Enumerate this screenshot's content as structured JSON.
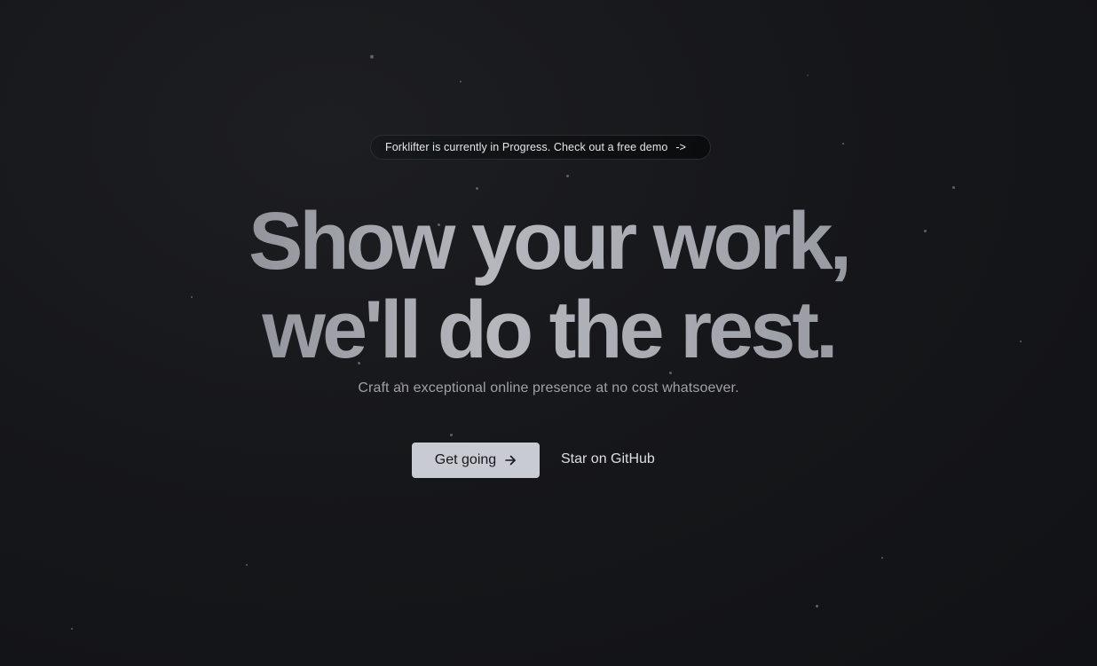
{
  "announcement": {
    "text": "Forklifter is currently in Progress. Check out a free demo",
    "arrow": "->"
  },
  "hero": {
    "headline_line1": "Show your work,",
    "headline_line2": "we'll do the rest.",
    "subtitle": "Craft an exceptional online presence at no cost whatsoever."
  },
  "actions": {
    "primary_label": "Get going",
    "primary_icon": "arrow-right-icon",
    "secondary_label": "Star on GitHub"
  },
  "colors": {
    "background": "#141518",
    "primary_button_bg": "#c9cbd2",
    "primary_button_text": "#17181b",
    "subtitle": "#9ea1a8",
    "headline_gradient_start": "#7c7f86",
    "headline_gradient_mid": "#b5b7bd"
  }
}
